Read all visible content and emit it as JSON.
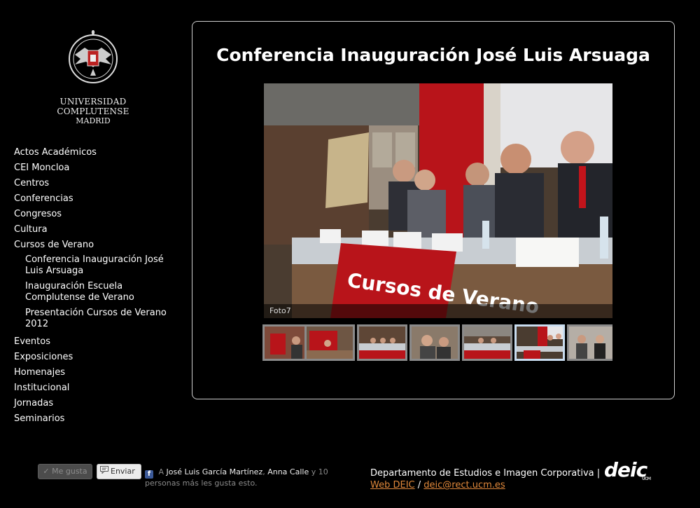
{
  "logo": {
    "name": "UNIVERSIDAD COMPLUTENSE",
    "city": "MADRID"
  },
  "nav": {
    "items": [
      {
        "label": "Actos Académicos"
      },
      {
        "label": "CEI Moncloa"
      },
      {
        "label": "Centros"
      },
      {
        "label": "Conferencias"
      },
      {
        "label": "Congresos"
      },
      {
        "label": "Cultura"
      },
      {
        "label": "Cursos de Verano"
      },
      {
        "label": "Eventos"
      },
      {
        "label": "Exposiciones"
      },
      {
        "label": "Homenajes"
      },
      {
        "label": "Institucional"
      },
      {
        "label": "Jornadas"
      },
      {
        "label": "Seminarios"
      }
    ],
    "subitems": [
      {
        "label": "Conferencia Inauguración José Luis Arsuaga"
      },
      {
        "label": "Inauguración Escuela Complutense de Verano"
      },
      {
        "label": "Presentación Cursos de Verano 2012"
      }
    ]
  },
  "gallery": {
    "title": "Conferencia Inauguración José Luis Arsuaga",
    "caption": "Foto7",
    "banner_text": "Cursos de Verano",
    "active_thumb": 6,
    "thumb_count": 7
  },
  "facebook": {
    "like_label": "Me gusta",
    "send_label": "Enviar",
    "prefix": "A",
    "friend1": "José Luis García Martínez",
    "separator": ",",
    "friend2": "Anna Calle",
    "suffix": "y 10 personas más les gusta esto."
  },
  "footer": {
    "department": "Departamento de Estudios e Imagen Corporativa",
    "divider": "|",
    "web_link": "Web DEIC",
    "slash": "/",
    "email": "deic@rect.ucm.es",
    "deic_logo": "deic",
    "deic_mark": "UCM"
  },
  "colors": {
    "background": "#000000",
    "link_orange": "#e0883a",
    "banner_red": "#b8141a"
  }
}
